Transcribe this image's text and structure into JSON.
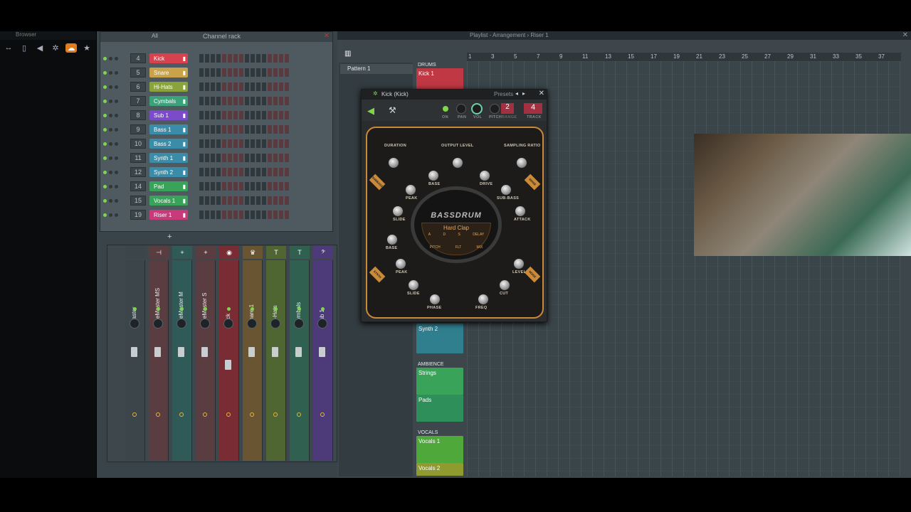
{
  "browser": {
    "title": "Browser"
  },
  "channel_rack": {
    "title": "Channel rack",
    "filter": "All",
    "channels": [
      {
        "num": "4",
        "name": "Kick",
        "color": "#d8424f"
      },
      {
        "num": "5",
        "name": "Snare",
        "color": "#c9a24a"
      },
      {
        "num": "6",
        "name": "Hi-Hats",
        "color": "#8aa33a"
      },
      {
        "num": "7",
        "name": "Cymbals",
        "color": "#3aa37a"
      },
      {
        "num": "8",
        "name": "Sub 1",
        "color": "#7b4bc9"
      },
      {
        "num": "9",
        "name": "Bass 1",
        "color": "#3a8ca8"
      },
      {
        "num": "10",
        "name": "Bass 2",
        "color": "#3a8ca8"
      },
      {
        "num": "11",
        "name": "Synth 1",
        "color": "#3a8ca8"
      },
      {
        "num": "12",
        "name": "Synth 2",
        "color": "#3a8ca8"
      },
      {
        "num": "14",
        "name": "Pad",
        "color": "#3aa35a"
      },
      {
        "num": "15",
        "name": "Vocals 1",
        "color": "#3aa35a"
      },
      {
        "num": "19",
        "name": "Riser 1",
        "color": "#c93a7a"
      }
    ]
  },
  "mixer": {
    "strips": [
      {
        "name": "Master",
        "head": "",
        "color": "#3b454a"
      },
      {
        "name": "PreMaster MS",
        "head": "⊣",
        "color": "#5a3d40"
      },
      {
        "name": "PreMaster M",
        "head": "+",
        "color": "#2f5a58"
      },
      {
        "name": "PreMaster S",
        "head": "+",
        "color": "#5a3d40"
      },
      {
        "name": "Kick",
        "head": "◉",
        "color": "#7a2c35"
      },
      {
        "name": "Snare 1",
        "head": "♛",
        "color": "#6a5532"
      },
      {
        "name": "Hi-Hats",
        "head": "T",
        "color": "#4f6532"
      },
      {
        "name": "Cymbals",
        "head": "T",
        "color": "#2f6050"
      },
      {
        "name": "Sub 1",
        "head": "𝄢",
        "color": "#4d3a78"
      }
    ]
  },
  "playlist": {
    "title": "Playlist - Arrangement › Riser 1",
    "pattern": "Pattern 1",
    "ruler": [
      "1",
      "3",
      "5",
      "7",
      "9",
      "11",
      "13",
      "15",
      "17",
      "19",
      "21",
      "23",
      "25",
      "27",
      "29",
      "31",
      "33",
      "35",
      "37"
    ],
    "groups": {
      "drums": "DRUMS",
      "ambience": "AMBIENCE",
      "vocals": "VOCALS"
    },
    "tracks": {
      "kick": "Kick 1",
      "synth2": "Synth 2",
      "strings": "Strings",
      "pads": "Pads",
      "vocals1": "Vocals 1",
      "vocals2": "Vocals 2"
    }
  },
  "plugin": {
    "title": "Kick (Kick)",
    "presets": "Presets",
    "header_labels": {
      "on": "ON",
      "pan": "PAN",
      "vol": "VOL",
      "pitch": "PITCH",
      "range": "RANGE",
      "range_value": "2",
      "track": "TRACK",
      "track_value": "4"
    },
    "logo": "BASSDRUM",
    "preset_name": "Hard Clap",
    "inner_labels": {
      "a": "A",
      "d": "D",
      "s": "S",
      "delay": "DELAY",
      "pitch": "PITCH",
      "flt": "FLT",
      "mix": "MIX"
    },
    "knob_labels": {
      "duration": "DURATION",
      "output_level": "OUTPUT LEVEL",
      "sampling_ratio": "SAMPLING RATIO",
      "base_top": "BASE",
      "drive": "DRIVE",
      "peak_top": "PEAK",
      "sub_bass": "SUB-BASS",
      "slide_top": "SLIDE",
      "attack": "ATTACK",
      "base_bottom": "BASE",
      "peak_bottom": "PEAK",
      "level": "LEVEL",
      "slide_bottom": "SLIDE",
      "cut": "CUT",
      "phase": "PHASE",
      "freq": "FREQ"
    },
    "side_tags": {
      "left_top": "SUBBASS",
      "right_top": "NOISE",
      "left_bottom": "SYNTH",
      "right_bottom": "NOISE"
    }
  }
}
